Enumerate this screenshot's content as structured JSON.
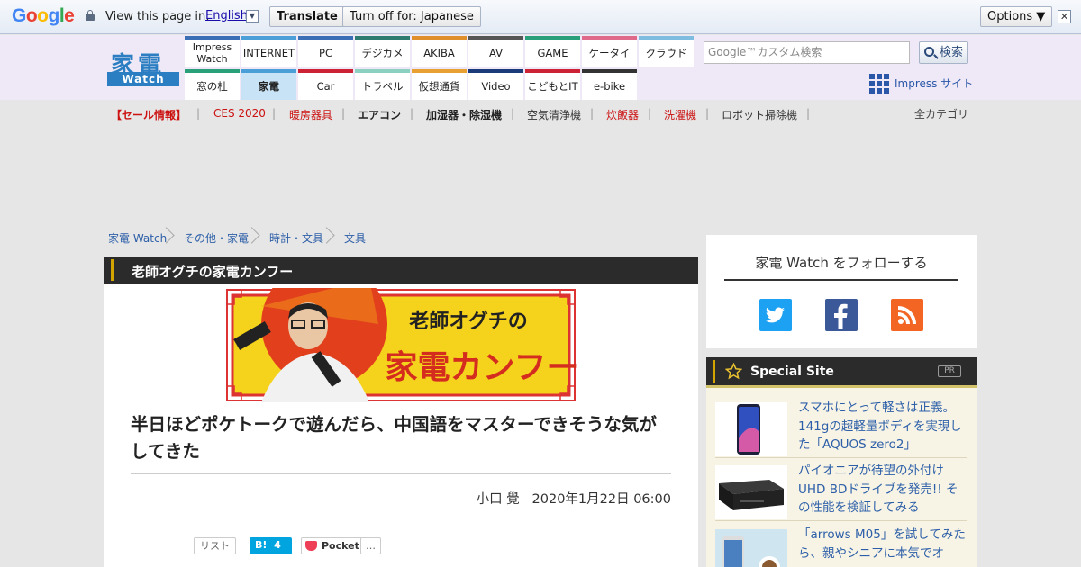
{
  "translate_bar": {
    "view_text": "View this page in:",
    "language": "English",
    "translate_label": "Translate",
    "turn_off_label": "Turn off for: Japanese",
    "options_label": "Options ▼",
    "close_symbol": "✕"
  },
  "site": {
    "logo_text": "家電",
    "logo_sub": "Watch",
    "nav_top": [
      "Impress Watch",
      "INTERNET",
      "PC",
      "デジカメ",
      "AKIBA",
      "AV",
      "GAME",
      "ケータイ",
      "クラウド"
    ],
    "nav_bottom": [
      "窓の杜",
      "家電",
      "Car",
      "トラベル",
      "仮想通貨",
      "Video",
      "こどもとIT",
      "e-bike"
    ],
    "nav_top_colors": [
      "#3a6fb5",
      "#4a9fd8",
      "#3a6fb5",
      "#2d7c6f",
      "#e0902a",
      "#555555",
      "#2aa07a",
      "#e06a8a",
      "#7fbde0"
    ],
    "nav_bottom_colors": [
      "#2aa07a",
      "#4a9fd8",
      "#cc2233",
      "#8bd0c0",
      "#e8a033",
      "#1a3a7a",
      "#cc2233",
      "#333333"
    ],
    "search_placeholder": "Google™カスタム検索",
    "search_button": "検索",
    "impress_link": "Impress サイト"
  },
  "categories": {
    "items": [
      "【セール情報】",
      "CES 2020",
      "暖房器具",
      "エアコン",
      "加湿器・除湿機",
      "空気清浄機",
      "炊飯器",
      "洗濯機",
      "ロボット掃除機"
    ],
    "all": "全カテゴリ"
  },
  "breadcrumb": [
    "家電 Watch",
    "その他・家電",
    "時計・文具",
    "文具"
  ],
  "article": {
    "column_title": "老師オグチの家電カンフー",
    "banner_small": "老師オグチの",
    "banner_big": "家電カンフー",
    "headline": "半日ほどポケトークで遊んだら、中国語をマスターできそうな気がしてきた",
    "author": "小口 覺",
    "date": "2020年1月22日 06:00",
    "share": {
      "list": "リスト",
      "hatena_label": "B!",
      "hatena_count": "4",
      "pocket": "Pocket",
      "more": "…"
    }
  },
  "sidebar": {
    "follow_title": "家電 Watch をフォローする",
    "special_title": "Special Site",
    "pr_badge": "PR",
    "special_items": [
      {
        "text": "スマホにとって軽さは正義。141gの超軽量ボディを実現した「AQUOS zero2」"
      },
      {
        "text": "パイオニアが待望の外付けUHD BDドライブを発売!! その性能を検証してみる"
      },
      {
        "text": "「arrows M05」を試してみたら、親やシニアに本気でオ"
      }
    ]
  }
}
